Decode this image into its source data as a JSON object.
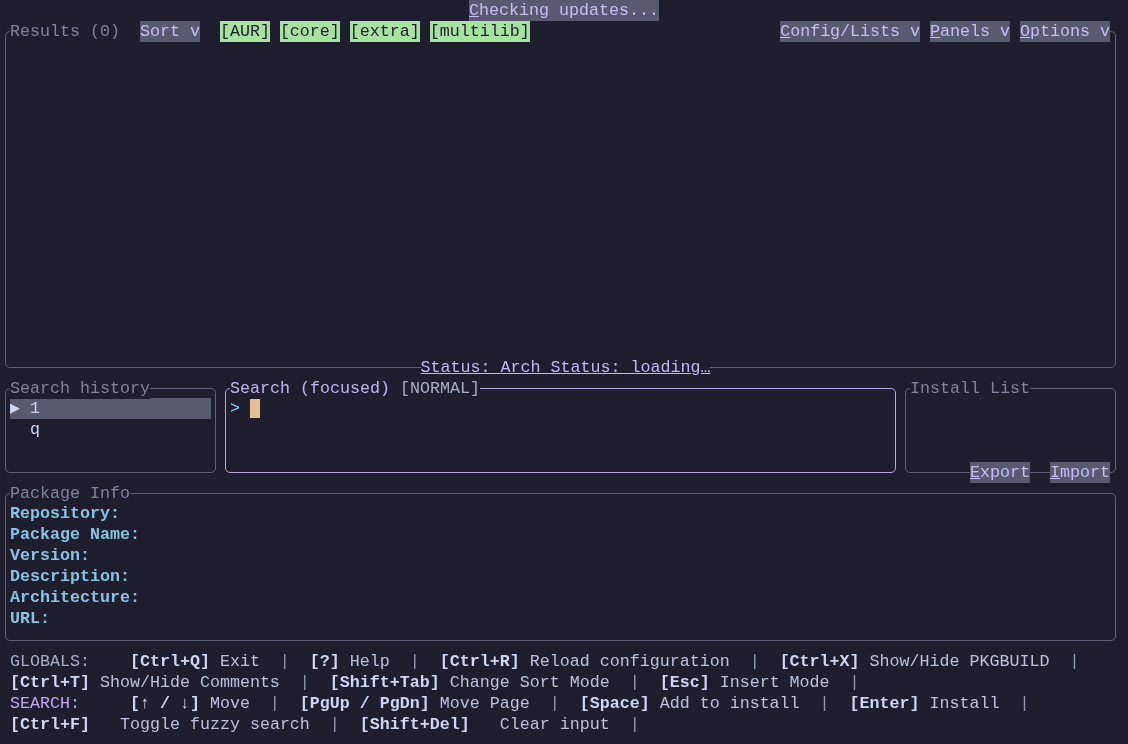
{
  "update_status": {
    "text": "Checking updates...",
    "mnemonic": true
  },
  "results": {
    "title": "Results (0)",
    "sort_button": {
      "label": "Sort v"
    },
    "repo_filters": [
      {
        "label": "[AUR]",
        "on": true
      },
      {
        "label": "[core]",
        "on": true
      },
      {
        "label": "[extra]",
        "on": true
      },
      {
        "label": "[multilib]",
        "on": true
      }
    ],
    "menus": [
      {
        "label": "Config/Lists v",
        "mnemonic": true
      },
      {
        "label": "Panels v",
        "mnemonic": true
      },
      {
        "label": "Options v",
        "mnemonic": true
      }
    ],
    "status": "Status: Arch Status: loading…"
  },
  "search_history": {
    "title": "Search history",
    "selection_marker": "▶",
    "items": [
      {
        "text": "1",
        "selected": true
      },
      {
        "text": "q",
        "selected": false
      }
    ]
  },
  "search": {
    "title": "Search (focused)",
    "mode": "[NORMAL]",
    "focused": true,
    "prompt": ">"
  },
  "install_list": {
    "title": "Install List",
    "buttons": [
      {
        "label": "Export",
        "mnemonic": true
      },
      {
        "label": "Import",
        "mnemonic": true
      }
    ]
  },
  "package_info": {
    "title": "Package Info",
    "fields": [
      "Repository:",
      "Package Name:",
      "Version:",
      "Description:",
      "Architecture:",
      "URL:"
    ]
  },
  "footer": {
    "separator": "|",
    "sections": [
      {
        "label": "GLOBALS:",
        "color": "#a6adc8",
        "lines": [
          [
            {
              "key": "[Ctrl+Q]",
              "action": "Exit"
            },
            {
              "key": "[?]",
              "action": "Help"
            },
            {
              "key": "[Ctrl+R]",
              "action": "Reload configuration"
            },
            {
              "key": "[Ctrl+X]",
              "action": "Show/Hide PKGBUILD"
            }
          ],
          [
            {
              "key": "[Ctrl+T]",
              "action": "Show/Hide Comments"
            },
            {
              "key": "[Shift+Tab]",
              "action": "Change Sort Mode"
            },
            {
              "key": "[Esc]",
              "action": "Insert Mode"
            }
          ]
        ]
      },
      {
        "label": "SEARCH:",
        "color": "#c3a6f5",
        "lines": [
          [
            {
              "key": "[↑ / ↓]",
              "action": "Move"
            },
            {
              "key": "[PgUp / PgDn]",
              "action": "Move Page"
            },
            {
              "key": "[Space]",
              "action": "Add to install"
            },
            {
              "key": "[Enter]",
              "action": "Install"
            }
          ],
          [
            {
              "key": "[Ctrl+F]",
              "action": "Toggle fuzzy search"
            },
            {
              "key": "[Shift+Del]",
              "action": "Clear input"
            }
          ]
        ]
      }
    ]
  }
}
